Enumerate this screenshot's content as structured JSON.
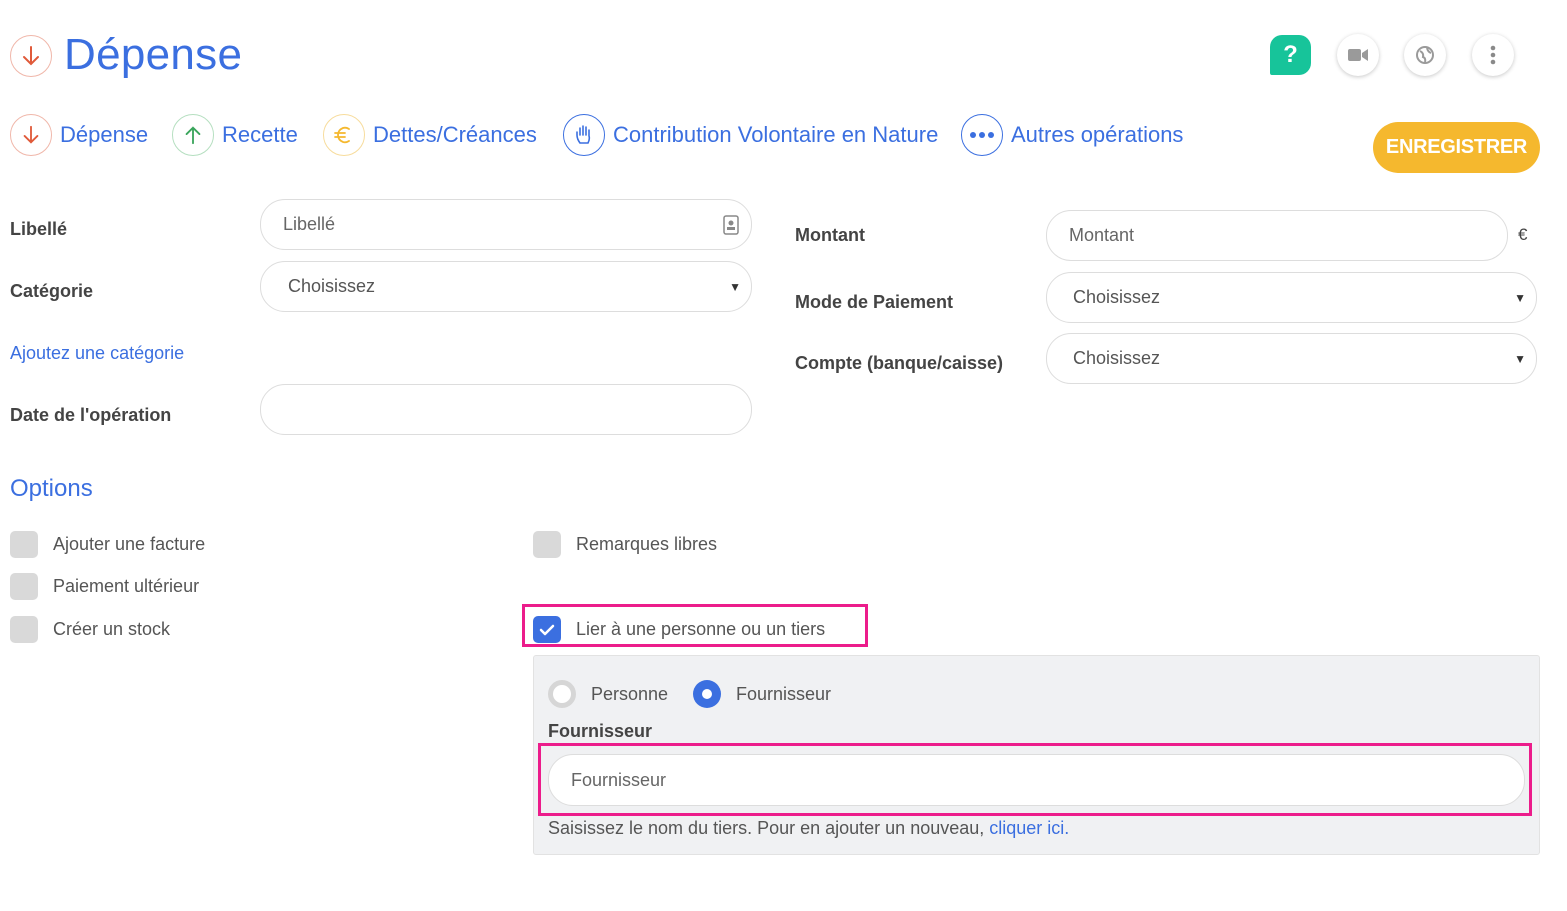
{
  "header": {
    "title": "Dépense",
    "help_label": "?",
    "icons": [
      "arrow-down-icon",
      "help-icon",
      "video-icon",
      "globe-icon",
      "more-vertical-icon"
    ]
  },
  "operation_types": [
    {
      "label": "Dépense",
      "icon": "arrow-down-icon",
      "color": "#e05a3a"
    },
    {
      "label": "Recette",
      "icon": "arrow-up-icon",
      "color": "#3aa55c"
    },
    {
      "label": "Dettes/Créances",
      "icon": "euro-icon",
      "color": "#f5b82e"
    },
    {
      "label": "Contribution Volontaire en Nature",
      "icon": "hand-icon",
      "color": "#3b6fe0"
    },
    {
      "label": "Autres opérations",
      "icon": "more-horizontal-icon",
      "color": "#3b6fe0"
    }
  ],
  "save_label": "ENREGISTRER",
  "form": {
    "libelle": {
      "label": "Libellé",
      "placeholder": "Libellé",
      "value": ""
    },
    "categorie": {
      "label": "Catégorie",
      "selected": "Choisissez"
    },
    "add_category_link": "Ajoutez une catégorie",
    "date": {
      "label": "Date de l'opération",
      "value": ""
    },
    "montant": {
      "label": "Montant",
      "placeholder": "Montant",
      "currency": "€"
    },
    "mode_paiement": {
      "label": "Mode de Paiement",
      "selected": "Choisissez"
    },
    "compte": {
      "label": "Compte (banque/caisse)",
      "selected": "Choisissez"
    }
  },
  "options": {
    "title": "Options",
    "items": [
      {
        "label": "Ajouter une facture",
        "checked": false
      },
      {
        "label": "Paiement ultérieur",
        "checked": false
      },
      {
        "label": "Créer un stock",
        "checked": false
      },
      {
        "label": "Remarques libres",
        "checked": false
      },
      {
        "label": "Lier à une personne ou un tiers",
        "checked": true
      }
    ]
  },
  "tiers_panel": {
    "radio_personne": "Personne",
    "radio_fournisseur": "Fournisseur",
    "selected": "Fournisseur",
    "field_label": "Fournisseur",
    "field_placeholder": "Fournisseur",
    "help_text": "Saisissez le nom du tiers. Pour en ajouter un nouveau, ",
    "help_link": "cliquer ici."
  },
  "colors": {
    "primary": "#3b6fe0",
    "save": "#f5b82e",
    "help": "#17c49a",
    "highlight": "#ec1c8b"
  }
}
